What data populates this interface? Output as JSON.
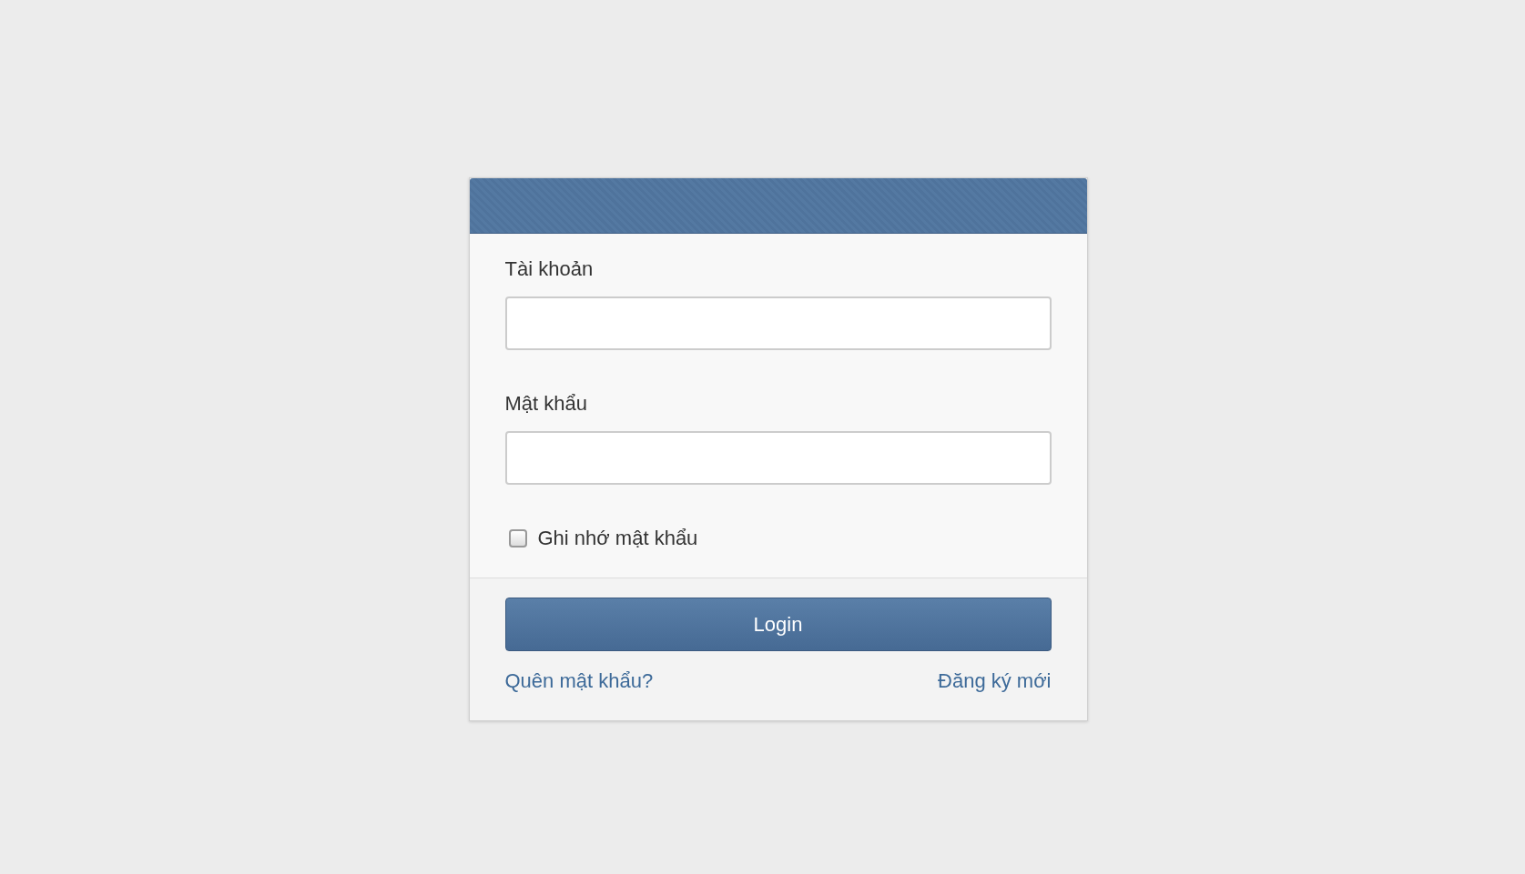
{
  "form": {
    "fields": [
      {
        "label": "Tài khoản"
      },
      {
        "label": "Mật khẩu"
      }
    ],
    "remember": {
      "label": "Ghi nhớ mật khẩu",
      "checked": false
    },
    "submit": "Login",
    "links": [
      {
        "label": "Quên mật khẩu?"
      },
      {
        "label": "Đăng ký mới"
      }
    ]
  }
}
